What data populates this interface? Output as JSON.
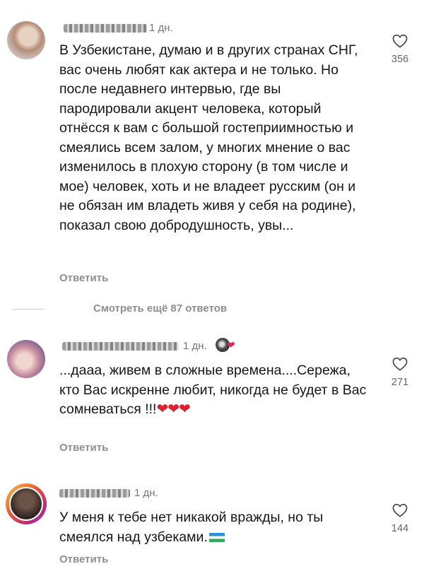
{
  "comments": [
    {
      "time": "1 дн.",
      "text": "В Узбекистане, думаю и в других странах СНГ, вас очень любят как актера и не только. Но после недавнего интервью, где вы пародировали акцент человека, который отнёсся к вам с большой гостеприимностью и смеялись всем залом, у многих мнение о вас изменилось в плохую сторону (в том числе и мое)  человек, хоть и не владеет русским (он и не обязан им владеть живя у себя на родине), показал свою добродушность, увы...",
      "likes": "356",
      "reply_label": "Ответить"
    },
    {
      "time": "1 дн.",
      "text": "...дааа, живем в сложные времена....Сережа, кто Вас искренне любит, никогда не будет в Вас сомневаться !!!",
      "emoji": "❤❤❤",
      "likes": "271",
      "reply_label": "Ответить"
    },
    {
      "time": "1 дн.",
      "text": "У меня к тебе нет никакой вражды, но ты смеялся над узбеками.",
      "likes": "144",
      "reply_label": "Ответить"
    }
  ],
  "view_more_replies": "Смотреть ещё 87 ответов",
  "icons": {
    "like": "heart-outline-icon",
    "flag": "uzbekistan-flag-emoji"
  },
  "colors": {
    "secondary_text": "#8e8e8e",
    "heart": "#e0202e"
  }
}
